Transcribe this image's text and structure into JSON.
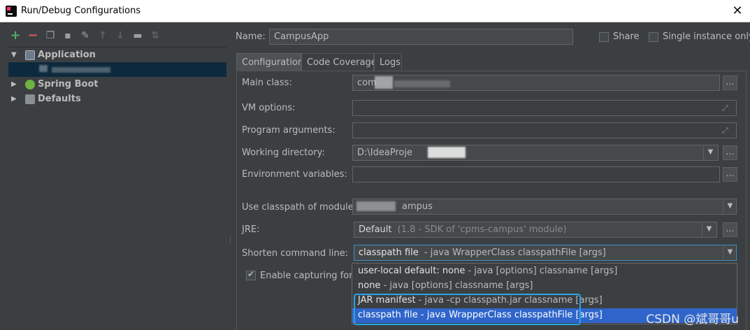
{
  "window": {
    "title": "Run/Debug Configurations"
  },
  "toolbar": {
    "icons": [
      "add-icon",
      "remove-icon",
      "copy-icon",
      "save-icon",
      "wrench-icon",
      "arrow-up-icon",
      "arrow-down-icon",
      "folder-icon",
      "sort-icon"
    ]
  },
  "tree": {
    "application_label": "Application",
    "spring_boot_label": "Spring Boot",
    "defaults_label": "Defaults"
  },
  "name": {
    "label": "Name:",
    "value": "CampusApp"
  },
  "share": {
    "label": "Share",
    "checked": false
  },
  "single_instance": {
    "label": "Single instance only",
    "checked": false
  },
  "tabs": [
    {
      "label": "Configuration",
      "active": true
    },
    {
      "label": "Code Coverage",
      "active": false
    },
    {
      "label": "Logs",
      "active": false
    }
  ],
  "form": {
    "main_class": {
      "label": "Main class:",
      "value": "com"
    },
    "vm_options": {
      "label": "VM options:",
      "value": ""
    },
    "program_arguments": {
      "label": "Program arguments:",
      "value": ""
    },
    "working_directory": {
      "label": "Working directory:",
      "value": "D:\\IdeaProje"
    },
    "environment_variables": {
      "label": "Environment variables:",
      "value": ""
    },
    "classpath_module": {
      "label": "Use classpath of module:",
      "value": "ampus"
    },
    "jre": {
      "label": "JRE:",
      "value": "Default",
      "detail": "(1.8 - SDK of 'cpms-campus' module)"
    },
    "shorten_command_line": {
      "label": "Shorten command line:",
      "value": "classpath file",
      "detail": "- java WrapperClass classpathFile [args]"
    },
    "enable_capturing": {
      "label": "Enable capturing form",
      "checked": true
    }
  },
  "dropdown_options": [
    {
      "main": "user-local default: none",
      "detail": " - java [options] classname [args]"
    },
    {
      "main": "none",
      "detail": " - java [options] classname [args]"
    },
    {
      "main": "JAR manifest",
      "detail": " - java -cp classpath.jar classname [args]"
    },
    {
      "main": "classpath file",
      "detail": " - java WrapperClass classpathFile [args]"
    }
  ],
  "watermark": "CSDN @斌哥哥u",
  "colors": {
    "accent": "#2f65ca",
    "highlight_border": "#25a7e8",
    "selected_tree": "#0d293e"
  }
}
